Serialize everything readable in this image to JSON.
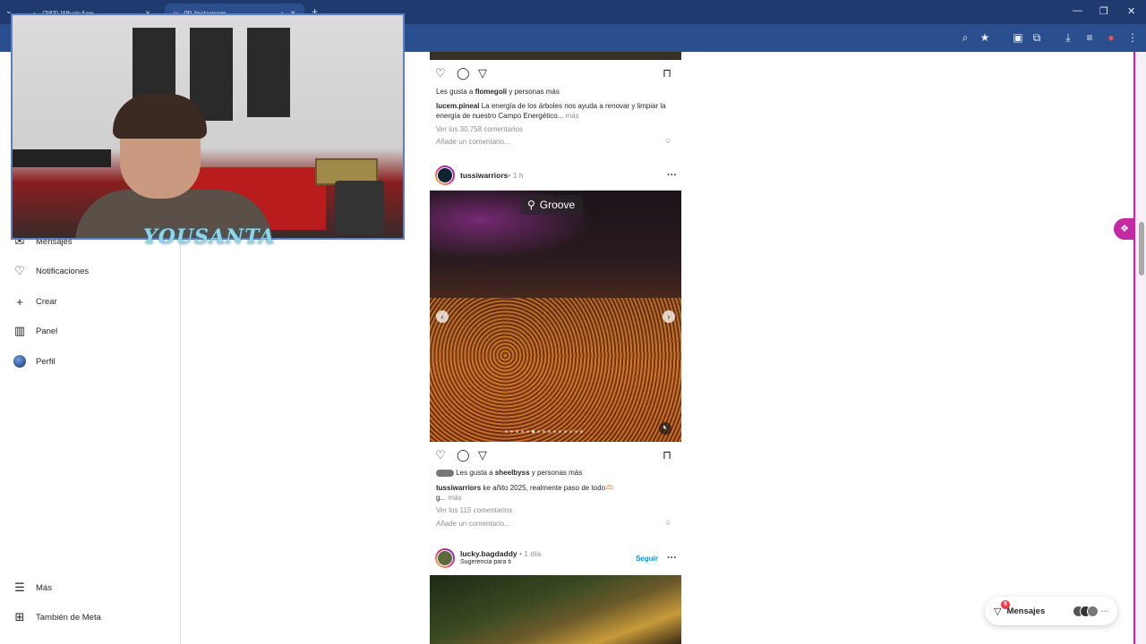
{
  "browser": {
    "tabs": [
      {
        "title": "(383) WhatsApp",
        "icon": "whatsapp-icon",
        "active": false
      },
      {
        "title": "(8) Instagram",
        "icon": "instagram-icon",
        "active": true
      }
    ],
    "new_tab": "+"
  },
  "sidebar": {
    "items": [
      {
        "label": "Mensajes",
        "icon": "messenger-icon"
      },
      {
        "label": "Notificaciones",
        "icon": "heart-icon"
      },
      {
        "label": "Crear",
        "icon": "plus-icon"
      },
      {
        "label": "Panel",
        "icon": "chart-icon"
      },
      {
        "label": "Perfil",
        "icon": "avatar"
      }
    ],
    "bottom": [
      {
        "label": "Más",
        "icon": "menu-icon"
      },
      {
        "label": "También de Meta",
        "icon": "meta-icon"
      }
    ]
  },
  "feed": {
    "post1": {
      "likes_prefix": "Les gusta a ",
      "likes_user": "flomegoli",
      "likes_suffix": " y personas más",
      "caption_user": "lucem.pineal",
      "caption_text": " La energía de los árboles nos ayuda a renovar y limpiar la energía de nuestro Campo Energético... ",
      "caption_more": "más",
      "comments": "Ver los 30.758 comentarios",
      "add_comment": "Añade un comentario..."
    },
    "post2": {
      "user": "tussiwarriors",
      "time": " • 1 h",
      "location": "Groove",
      "likes_prefix": "Les gusta a ",
      "likes_user": "sheelbyss",
      "likes_suffix": " y personas más",
      "caption_user": "tussiwarriors",
      "caption_text": " ke añito 2025, realmente paso de todo🫶🏻",
      "caption_cont": "g... ",
      "caption_more": "más",
      "comments": "Ver los 115 comentarios",
      "add_comment": "Añade un comentario...",
      "carousel_count": 15,
      "carousel_active": 5
    },
    "post3": {
      "user": "lucky.bagdaddy",
      "time": " • 1 día",
      "subtitle": "Sugerencia para ti",
      "follow": "Seguir"
    }
  },
  "messages_bubble": {
    "label": "Mensajes",
    "badge": "8"
  },
  "webcam": {
    "logo": "YOUSANTA"
  }
}
